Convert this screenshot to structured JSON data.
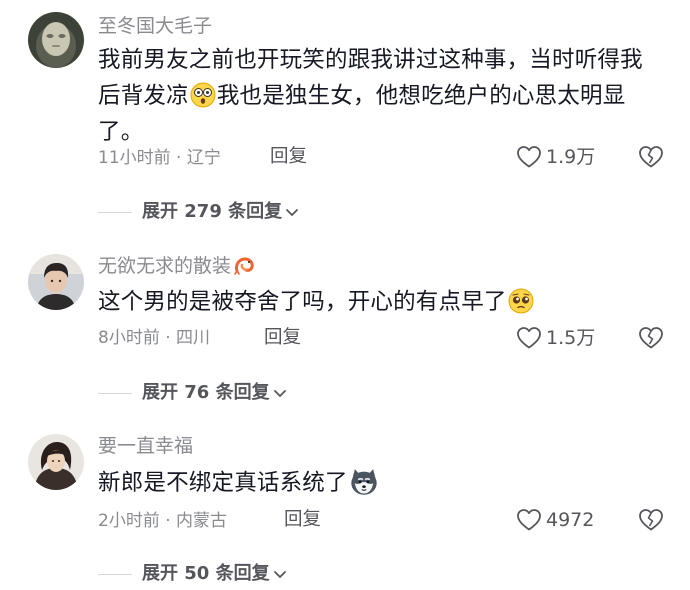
{
  "comments": [
    {
      "username": "至冬国大毛子",
      "text_1": "我前男友之前也开玩笑的跟我讲过这种事，当时听得我后背发凉",
      "text_2": "我也是独生女，他想吃绝户的心思太明显了。",
      "inline_emoji": "shocked-face-emoji",
      "time": "11小时前 · 辽宁",
      "reply_label": "回复",
      "likes": "1.9万",
      "expand_label": "展开 279 条回复"
    },
    {
      "username": "无欲无求的散装",
      "username_badge": "shrimp-emoji",
      "text_1": "这个男的是被夺舍了吗，开心的有点早了",
      "inline_emoji": "pleading-face-emoji",
      "time": "8小时前 · 四川",
      "reply_label": "回复",
      "likes": "1.5万",
      "expand_label": "展开 76 条回复"
    },
    {
      "username": "要一直幸福",
      "text_1": "新郎是不绑定真话系统了",
      "inline_emoji": "husky-dog-emoji",
      "time": "2小时前 · 内蒙古",
      "reply_label": "回复",
      "likes": "4972",
      "expand_label": "展开 50 条回复"
    }
  ],
  "colors": {
    "text_primary": "#161823",
    "text_secondary": "#8a8b91",
    "action": "#55565c"
  }
}
